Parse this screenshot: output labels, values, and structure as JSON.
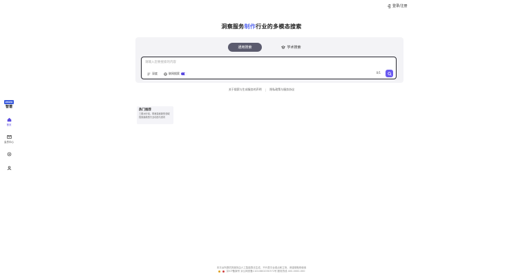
{
  "header": {
    "login_label": "登录/注册"
  },
  "sidebar": {
    "logo_badge": "ZHIPU",
    "logo_text": "智谱",
    "items": [
      {
        "label": "首页",
        "icon": "home-icon"
      },
      {
        "label": "会员中心",
        "icon": "mail-icon"
      },
      {
        "label": "",
        "icon": "settings-icon"
      },
      {
        "label": "",
        "icon": "user-icon"
      }
    ]
  },
  "headline": {
    "prefix": "洞察服务",
    "accent": "制作",
    "suffix": "行业的多模态搜索"
  },
  "search": {
    "tabs": [
      {
        "label": "通用搜索",
        "active": true
      },
      {
        "label": "学术搜索",
        "active": false
      }
    ],
    "placeholder": "请输入您要搜索的内容",
    "deep_label": "深度",
    "net_label": "联网搜索",
    "counter": "0/1"
  },
  "links": [
    "关于搜索与生成服务的声明",
    "隐私政策与服务协议"
  ],
  "recommend": {
    "title": "热门推荐",
    "lines": [
      "三角洲行动，带我探索新的领域",
      "找到最新的行业动态与资讯"
    ]
  },
  "footer": {
    "line1": "本平台所提供的服务由人工智能算法生成，不代表平台观点和立场，请谨慎甄别使用",
    "line2": "京ICP备案号  京公网安备11010802030371号  服务热线 400-0000-000"
  },
  "colors": {
    "accent": "#5b4be0",
    "tab_active": "#5b5b6e",
    "panel_bg": "#f3f3f6"
  }
}
